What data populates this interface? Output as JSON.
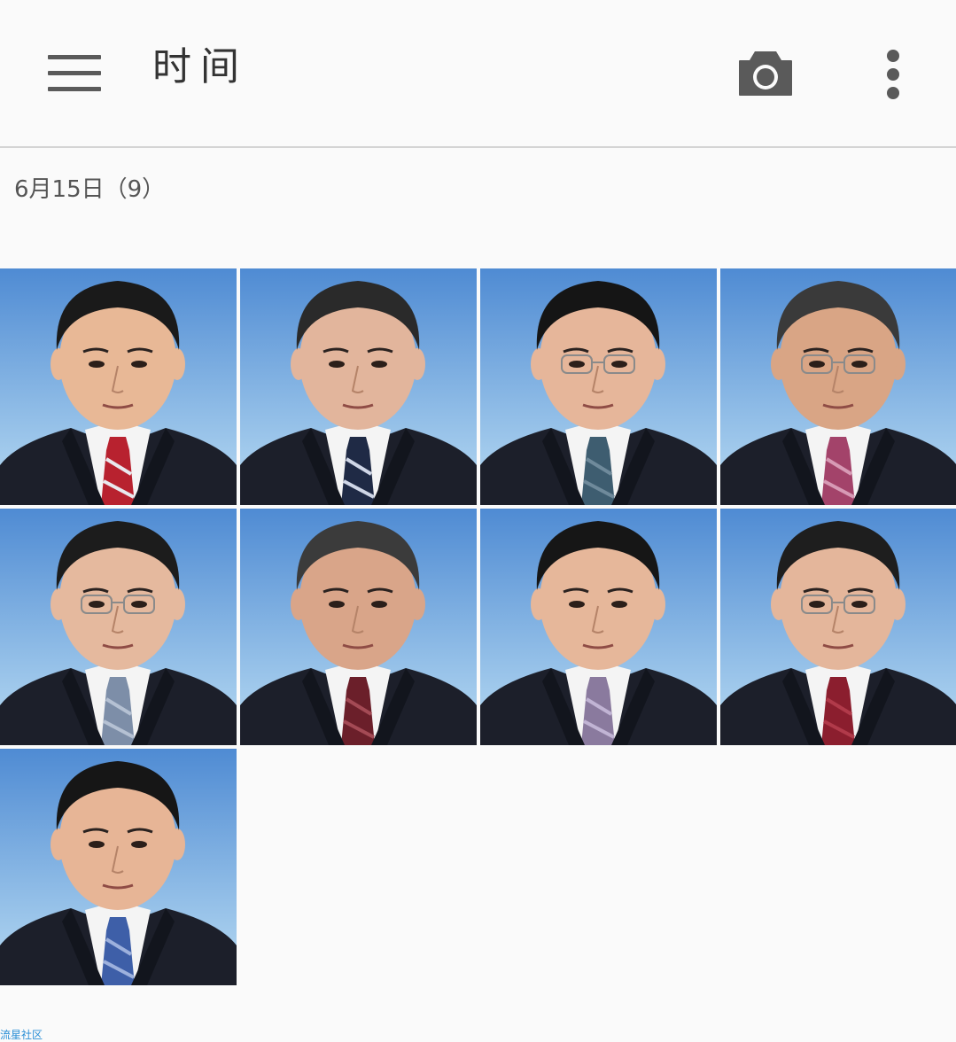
{
  "appbar": {
    "title": "时间",
    "menu_icon": "hamburger-menu-icon",
    "camera_icon": "camera-icon",
    "more_icon": "more-vertical-icon"
  },
  "section": {
    "date_label": "6月15日（9）"
  },
  "photos": [
    {
      "tie": "#b8222f",
      "stripe": "#e9e9ee",
      "hair": "#1a1a1a",
      "glasses": false,
      "shirt": "#f4f4f4",
      "skin": "#e8b896"
    },
    {
      "tie": "#1f2a45",
      "stripe": "#cfd6e6",
      "hair": "#2a2a2a",
      "glasses": false,
      "shirt": "#f4f4f4",
      "skin": "#e2b59c"
    },
    {
      "tie": "#3e5d70",
      "stripe": "#6f8a9b",
      "hair": "#151515",
      "glasses": true,
      "shirt": "#f4f4f4",
      "skin": "#e6b69a"
    },
    {
      "tie": "#a3436a",
      "stripe": "#d79ab5",
      "hair": "#3a3a3a",
      "glasses": true,
      "shirt": "#f4f4f4",
      "skin": "#d9a585"
    },
    {
      "tie": "#7d8ea8",
      "stripe": "#b5c1d3",
      "hair": "#1c1c1c",
      "glasses": true,
      "shirt": "#f4f4f4",
      "skin": "#e5b99e"
    },
    {
      "tie": "#6b1f2a",
      "stripe": "#a44a55",
      "hair": "#3b3b3b",
      "glasses": false,
      "shirt": "#f4f4f4",
      "skin": "#d9a589"
    },
    {
      "tie": "#8a7a9e",
      "stripe": "#c1b4d4",
      "hair": "#161616",
      "glasses": false,
      "shirt": "#f4f4f4",
      "skin": "#e6b79a"
    },
    {
      "tie": "#8b1e2e",
      "stripe": "#b13a4a",
      "hair": "#1e1e1e",
      "glasses": true,
      "shirt": "#f4f4f4",
      "skin": "#e4b69b"
    },
    {
      "tie": "#3e5fa8",
      "stripe": "#9db1dd",
      "hair": "#161616",
      "glasses": false,
      "shirt": "#f4f4f4",
      "skin": "#e7b596"
    }
  ],
  "watermark": "流星社区",
  "colors": {
    "background": "#fafafa",
    "icon": "#5a5a5a",
    "divider": "#d4d4d4",
    "photo_sky_top": "#4f8bd3",
    "photo_sky_bottom": "#b9dcf3",
    "suit": "#1c1f2a"
  }
}
